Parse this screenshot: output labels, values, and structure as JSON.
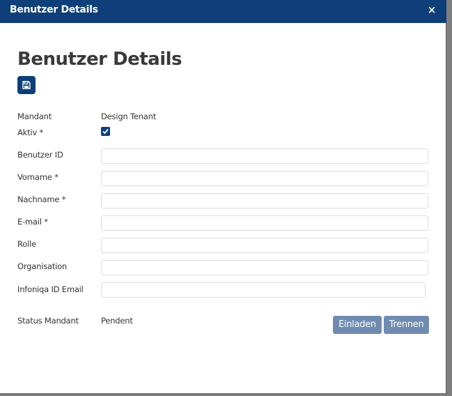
{
  "dialog": {
    "title": "Benutzer Details",
    "close_label": "×"
  },
  "page": {
    "heading": "Benutzer Details"
  },
  "fields": {
    "mandant_label": "Mandant",
    "mandant_value": "Design Tenant",
    "aktiv_label": "Aktiv *",
    "aktiv_checked": true,
    "benutzer_id_label": "Benutzer ID",
    "benutzer_id_value": "",
    "vorname_label": "Vorname *",
    "vorname_value": "",
    "nachname_label": "Nachname *",
    "nachname_value": "",
    "email_label": "E-mail *",
    "email_value": "",
    "rolle_label": "Rolle",
    "rolle_value": "",
    "organisation_label": "Organisation",
    "organisation_value": "",
    "infoniqa_label": "Infoniqa ID Email",
    "infoniqa_value": "",
    "status_label": "Status Mandant",
    "status_value": "Pendent"
  },
  "actions": {
    "einladen_label": "Einladen",
    "trennen_label": "Trennen"
  },
  "colors": {
    "primary": "#0e3f78",
    "button_muted": "#6f8cb0"
  },
  "icons": {
    "save": "floppy-disk-icon",
    "close": "close-icon",
    "check": "checkmark-icon"
  }
}
